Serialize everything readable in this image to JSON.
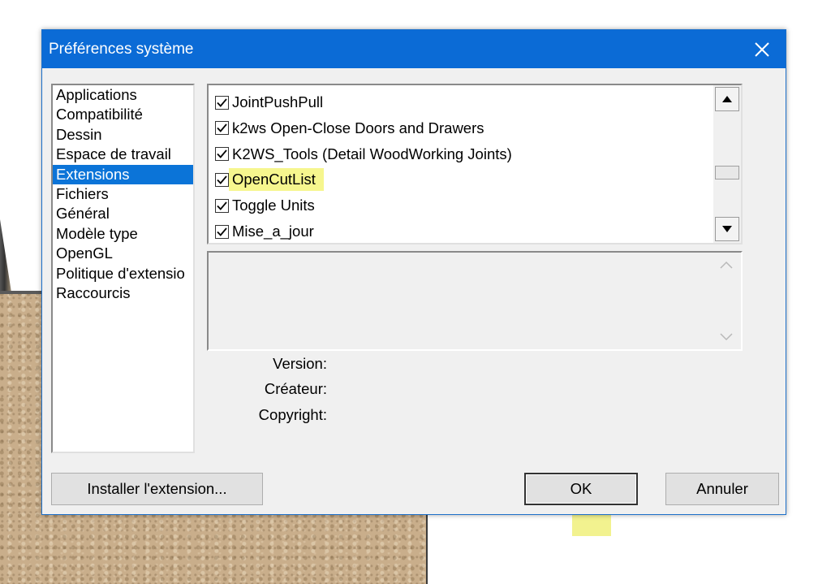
{
  "dialog": {
    "title": "Préférences système",
    "close_icon": "close-icon"
  },
  "categories": [
    {
      "label": "Applications",
      "selected": false
    },
    {
      "label": "Compatibilité",
      "selected": false
    },
    {
      "label": "Dessin",
      "selected": false
    },
    {
      "label": "Espace de travail",
      "selected": false
    },
    {
      "label": "Extensions",
      "selected": true
    },
    {
      "label": "Fichiers",
      "selected": false
    },
    {
      "label": "Général",
      "selected": false
    },
    {
      "label": "Modèle type",
      "selected": false
    },
    {
      "label": "OpenGL",
      "selected": false
    },
    {
      "label": "Politique d'extensio",
      "selected": false
    },
    {
      "label": "Raccourcis",
      "selected": false
    }
  ],
  "extensions": [
    {
      "label": "JointPushPull",
      "checked": true
    },
    {
      "label": "k2ws Open-Close Doors and Drawers",
      "checked": true
    },
    {
      "label": "K2WS_Tools (Detail WoodWorking Joints)",
      "checked": true
    },
    {
      "label": "OpenCutList",
      "checked": true,
      "highlighted": true
    },
    {
      "label": "Toggle Units",
      "checked": true
    },
    {
      "label": "Mise_a_jour",
      "checked": true
    }
  ],
  "details": {
    "version_label": "Version:",
    "creator_label": "Créateur:",
    "copyright_label": "Copyright:"
  },
  "buttons": {
    "install_label": "Installer l'extension...",
    "ok_label": "OK",
    "cancel_label": "Annuler"
  },
  "colors": {
    "titlebar": "#0b6bd6",
    "selection": "#0b74d8",
    "highlight": "#f6f68e"
  }
}
